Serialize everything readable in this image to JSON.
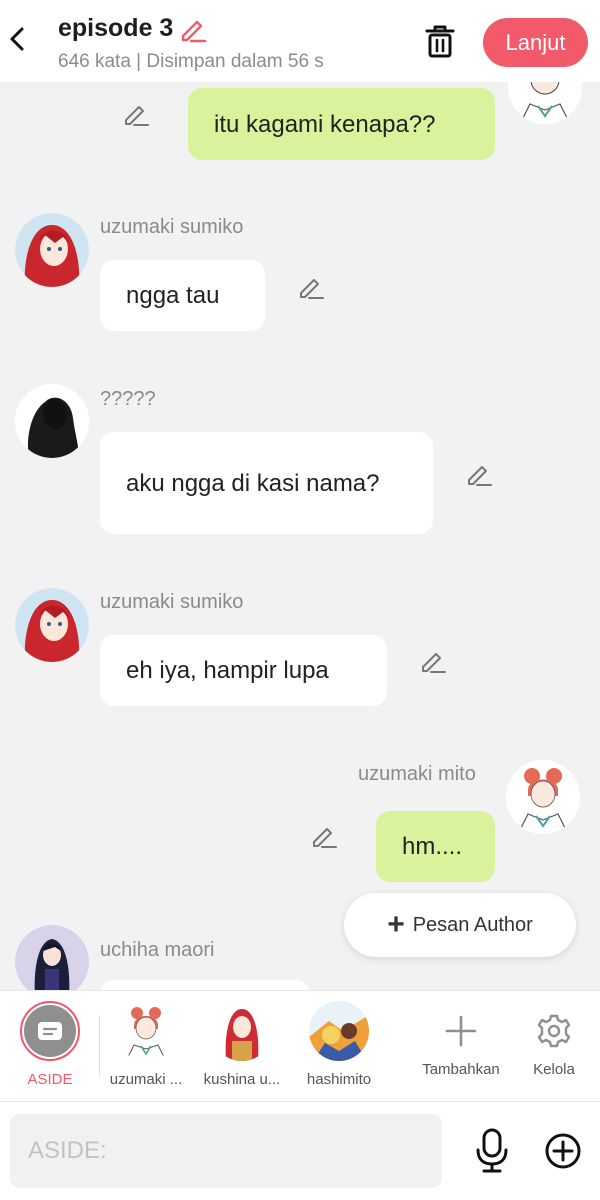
{
  "header": {
    "title": "episode 3",
    "subtitle": "646 kata | Disimpan dalam 56 s",
    "next_label": "Lanjut"
  },
  "messages": [
    {
      "sender": "",
      "text": "itu kagami kenapa??",
      "side": "right"
    },
    {
      "sender": "uzumaki sumiko",
      "text": "ngga tau",
      "side": "left"
    },
    {
      "sender": "?????",
      "text": "aku ngga di kasi nama?",
      "side": "left"
    },
    {
      "sender": "uzumaki sumiko",
      "text": "eh iya, hampir lupa",
      "side": "left"
    },
    {
      "sender": "uzumaki mito",
      "text": "hm....",
      "side": "right"
    },
    {
      "sender": "uchiha maori",
      "text": "",
      "side": "left"
    }
  ],
  "author_button": {
    "label": "Pesan Author"
  },
  "characters": [
    {
      "label": "ASIDE"
    },
    {
      "label": "uzumaki ..."
    },
    {
      "label": "kushina u..."
    },
    {
      "label": "hashimito"
    },
    {
      "label": "Tambahkan"
    },
    {
      "label": "Kelola"
    }
  ],
  "input": {
    "placeholder": "ASIDE:"
  },
  "colors": {
    "accent": "#f25a6b",
    "bubble_right": "#d8f39b",
    "bubble_left": "#ffffff",
    "background": "#f2f2f2"
  }
}
